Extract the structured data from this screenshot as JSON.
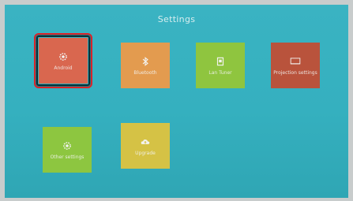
{
  "screen": {
    "title": "Settings"
  },
  "tiles": [
    {
      "label": "Android",
      "icon": "gear-icon",
      "color": "#d9674f"
    },
    {
      "label": "Bluetooth",
      "icon": "bluetooth-icon",
      "color": "#e39b4f"
    },
    {
      "label": "Lan Tuner",
      "icon": "screen-icon",
      "color": "#8fc53f"
    },
    {
      "label": "Projection settings",
      "icon": "projector-screen-icon",
      "color": "#b9533c"
    },
    {
      "label": "Other settings",
      "icon": "gear-icon",
      "color": "#8dc640"
    },
    {
      "label": "Upgrade",
      "icon": "cloud-upload-icon",
      "color": "#d5c245"
    }
  ],
  "colors": {
    "focus_border": "#d8242a",
    "background": "#38b1c0"
  }
}
